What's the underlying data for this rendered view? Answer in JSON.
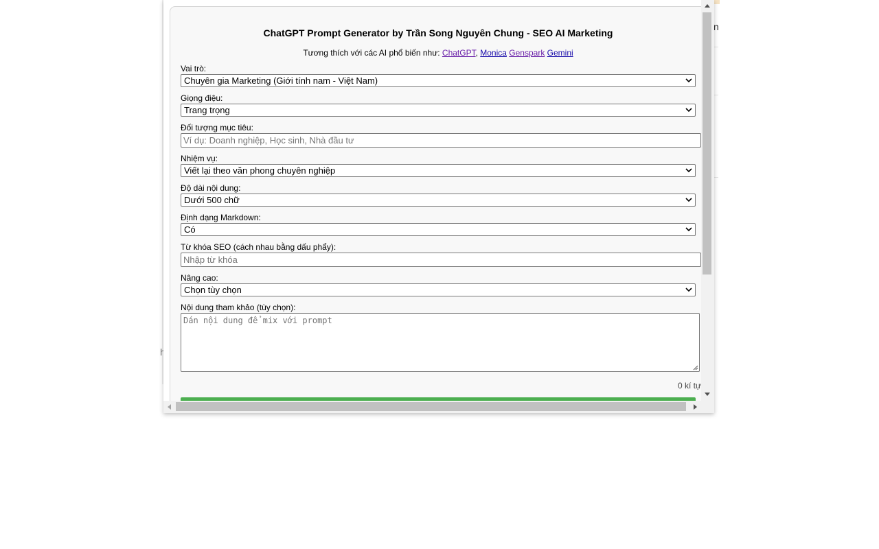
{
  "background": {
    "fragment_right": "n",
    "fragment_left": "h"
  },
  "form": {
    "title": "ChatGPT Prompt Generator by Trần Song Nguyên Chung - SEO AI Marketing",
    "compat_prefix": "Tương thích với các AI phổ biến như:",
    "links": [
      "ChatGPT",
      "Monica",
      "Genspark",
      "Gemini"
    ],
    "role": {
      "label": "Vai trò:",
      "value": "Chuyên gia Marketing (Giới tính nam - Việt Nam)"
    },
    "tone": {
      "label": "Giọng điệu:",
      "value": "Trang trọng"
    },
    "audience": {
      "label": "Đối tượng mục tiêu:",
      "placeholder": "Ví dụ: Doanh nghiệp, Học sinh, Nhà đầu tư"
    },
    "task": {
      "label": "Nhiệm vụ:",
      "value": "Viết lại theo văn phong chuyên nghiệp"
    },
    "length": {
      "label": "Độ dài nội dung:",
      "value": "Dưới 500 chữ"
    },
    "markdown": {
      "label": "Định dạng Markdown:",
      "value": "Có"
    },
    "keywords": {
      "label": "Từ khóa SEO (cách nhau bằng dấu phẩy):",
      "placeholder": "Nhập từ khóa"
    },
    "advanced": {
      "label": "Nâng cao:",
      "value": "Chọn tùy chọn"
    },
    "reference": {
      "label": "Nội dung tham khảo (tùy chọn):",
      "placeholder": "Dán nội dung để mix với prompt"
    },
    "char_count": "0 kí tự"
  },
  "colors": {
    "submit_green": "#4caf50",
    "link": "#1a0dab",
    "link_visited": "#681da8"
  }
}
